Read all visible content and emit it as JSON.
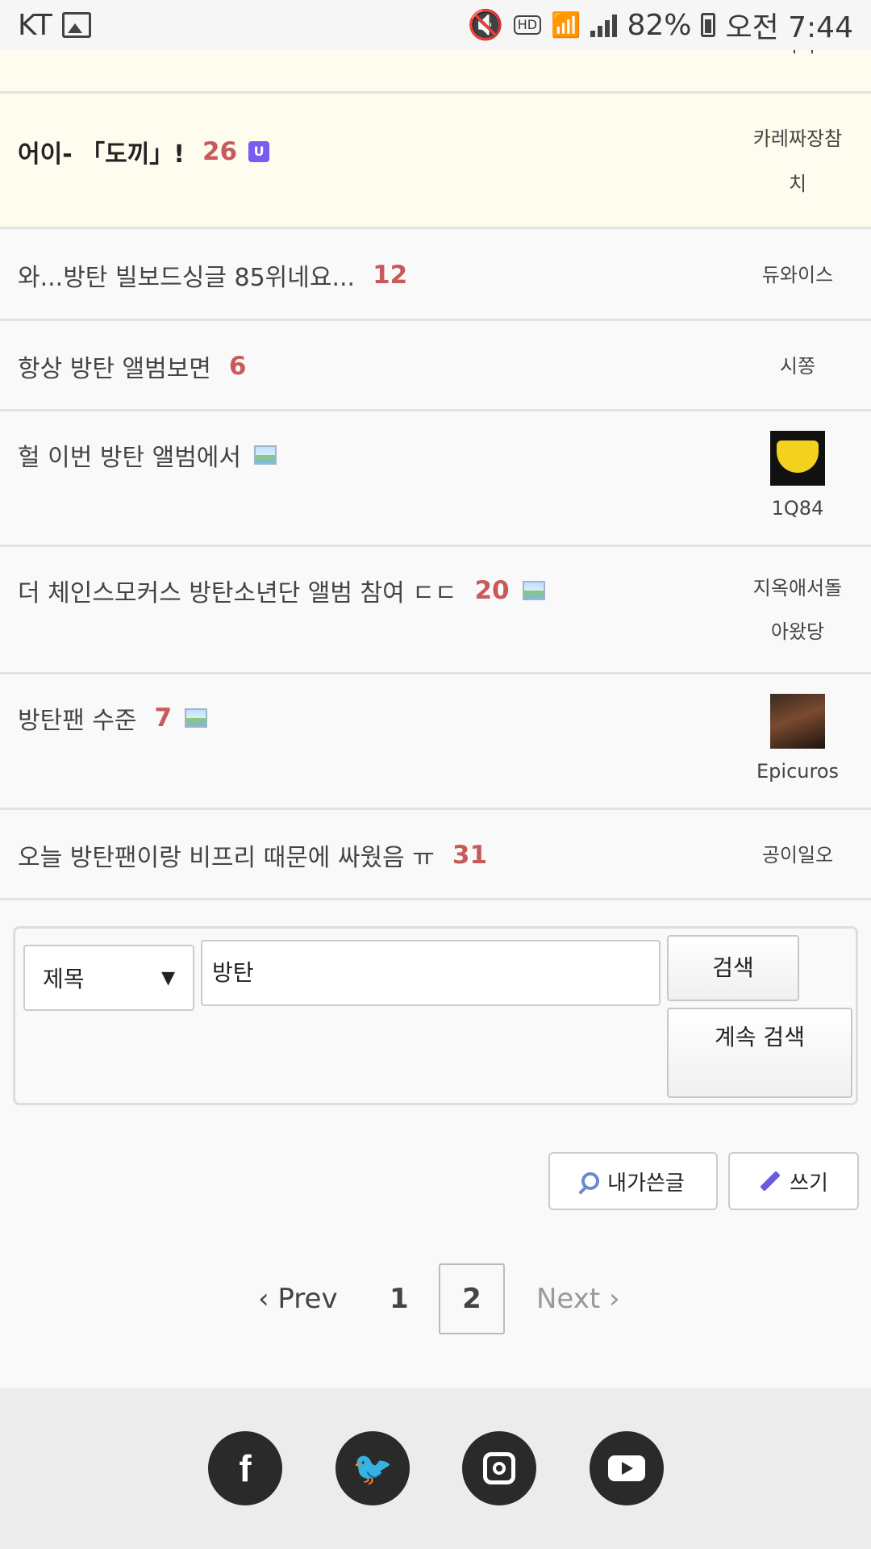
{
  "status_bar": {
    "carrier": "KT",
    "battery": "82%",
    "time": "오전 7:44",
    "icons": [
      "image-icon",
      "mute-icon",
      "hd-icon",
      "wifi-icon",
      "signal-icon",
      "battery-icon"
    ]
  },
  "top_row_partial": {
    "author": "너디"
  },
  "posts": [
    {
      "title": "어이- 「도끼」!",
      "count": "26",
      "badge": "U",
      "author": "카레짜장참치",
      "author_line1": "카레짜장참",
      "author_line2": "치"
    },
    {
      "title": "와...방탄 빌보드싱글 85위네요...",
      "count": "12",
      "author": "듀와이스"
    },
    {
      "title": "항상 방탄 앨범보면",
      "count": "6",
      "author": "시쫑"
    },
    {
      "title": "헐 이번 방탄 앨범에서",
      "count": "",
      "author": "1Q84",
      "has_image": true
    },
    {
      "title": "더 체인스모커스 방탄소년단 앨범 참여 ㄷㄷ",
      "count": "20",
      "author_line1": "지옥애서돌",
      "author_line2": "아왔당",
      "has_image": true
    },
    {
      "title": "방탄팬 수준",
      "count": "7",
      "author": "Epicuros",
      "has_image": true
    },
    {
      "title": "오늘 방탄팬이랑 비프리 때문에 싸웠음 ㅠ",
      "count": "31",
      "author": "공이일오"
    }
  ],
  "search": {
    "field_select": "제목",
    "query": "방탄",
    "search_button": "검색",
    "continue_button": "계속 검색"
  },
  "actions": {
    "my_posts": "내가쓴글",
    "write": "쓰기"
  },
  "pagination": {
    "prev": "‹ Prev",
    "pages": [
      "1",
      "2"
    ],
    "current": "2",
    "next": "Next ›"
  },
  "footer": {
    "social": [
      "facebook-icon",
      "twitter-icon",
      "instagram-icon",
      "youtube-icon"
    ],
    "fb_glyph": "f"
  },
  "colors": {
    "count": "#c85a5a",
    "highlight_row": "#fdfcee",
    "footer_bg": "#ececec"
  }
}
